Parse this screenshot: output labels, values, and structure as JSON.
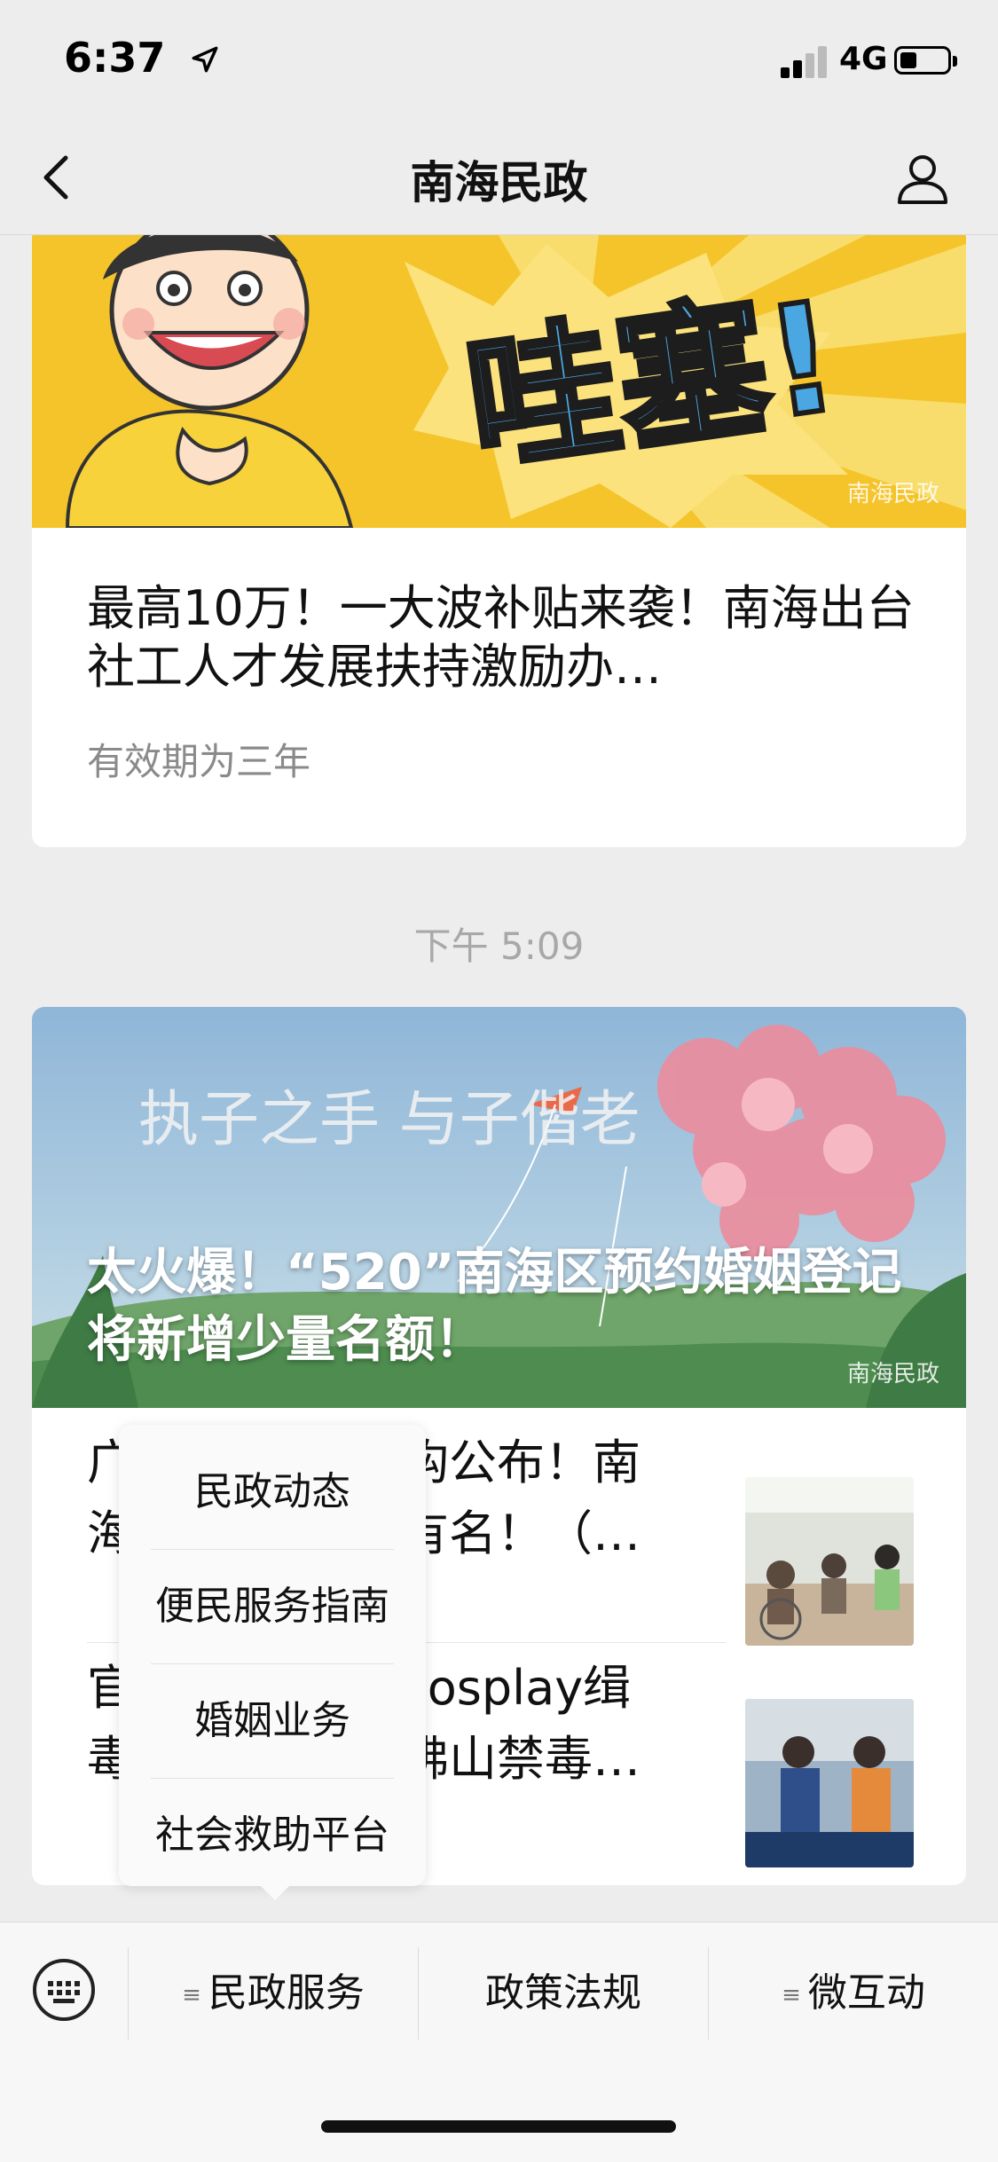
{
  "status_bar": {
    "time": "6:37",
    "carrier": "4G"
  },
  "nav": {
    "title": "南海民政"
  },
  "feed": {
    "card1": {
      "banner_text": "哇塞!",
      "watermark": "南海民政",
      "title": "最高10万！一大波补贴来袭！南海出台社工人才发展扶持激励办…",
      "subtitle": "有效期为三年"
    },
    "timestamp": "下午 5:09",
    "card2": {
      "banner_text": "执子之手 与子偕老",
      "watermark": "南海民政",
      "title": "太火爆！“520”南海区预约婚姻登记将新增少量名额！",
      "rows": [
        {
          "title_line1": "广",
          "title_line1_end": "构公布！南",
          "title_line2": "海",
          "title_line2_end": "有名！（…"
        },
        {
          "title_line1": "官",
          "title_line1_end": "cosplay缉",
          "title_line2": "毒",
          "title_line2_end": "佛山禁毒…"
        }
      ]
    }
  },
  "popup_menu": {
    "items": [
      "民政动态",
      "便民服务指南",
      "婚姻业务",
      "社会救助平台"
    ]
  },
  "bottom_menu": {
    "items": [
      "民政服务",
      "政策法规",
      "微互动"
    ]
  }
}
